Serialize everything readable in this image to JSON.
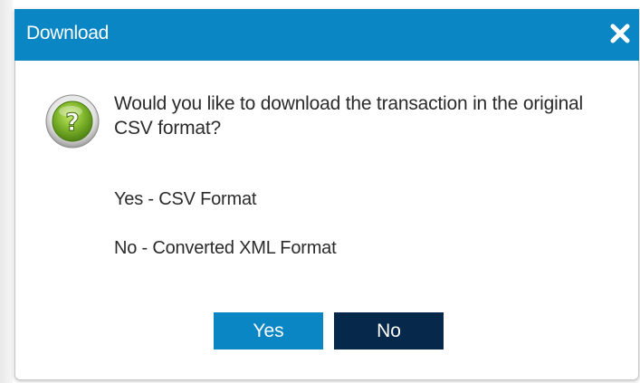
{
  "dialog": {
    "title": "Download",
    "close_icon": "close-icon",
    "question_icon": "question-icon",
    "message": "Would you like to download the transaction in the original CSV format?",
    "options": {
      "yes": "Yes - CSV Format",
      "no": "No - Converted XML Format"
    },
    "buttons": {
      "yes_label": "Yes",
      "no_label": "No"
    }
  },
  "colors": {
    "titlebar": "#0a86c4",
    "yes_button": "#0a86c4",
    "no_button": "#06284a",
    "icon_green": "#7db42a"
  }
}
